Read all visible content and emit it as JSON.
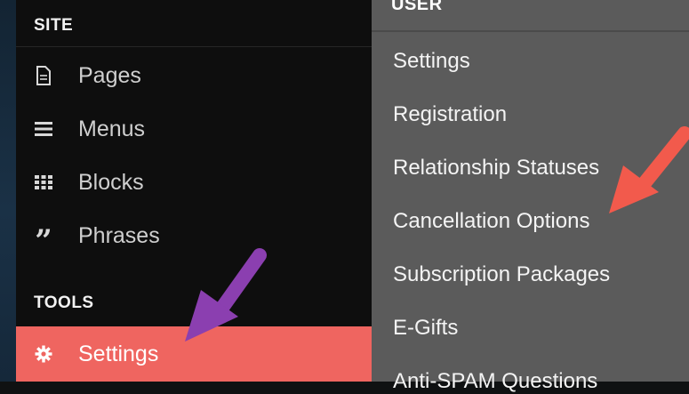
{
  "left_panel": {
    "site_header": "SITE",
    "site_items": [
      {
        "label": "Pages",
        "icon": "page-icon"
      },
      {
        "label": "Menus",
        "icon": "menu-icon"
      },
      {
        "label": "Blocks",
        "icon": "blocks-icon"
      },
      {
        "label": "Phrases",
        "icon": "quote-icon"
      }
    ],
    "tools_header": "TOOLS",
    "tools_items": [
      {
        "label": "Settings",
        "icon": "gear-icon",
        "active": true
      }
    ]
  },
  "right_panel": {
    "header": "USER",
    "items": [
      {
        "label": "Settings"
      },
      {
        "label": "Registration"
      },
      {
        "label": "Relationship Statuses"
      },
      {
        "label": "Cancellation Options"
      },
      {
        "label": "Subscription Packages"
      },
      {
        "label": "E-Gifts"
      },
      {
        "label": "Anti-SPAM Questions"
      }
    ]
  },
  "colors": {
    "active_item": "#ef6560",
    "purple_arrow": "#8b3fb0",
    "red_arrow": "#f25a4c"
  }
}
